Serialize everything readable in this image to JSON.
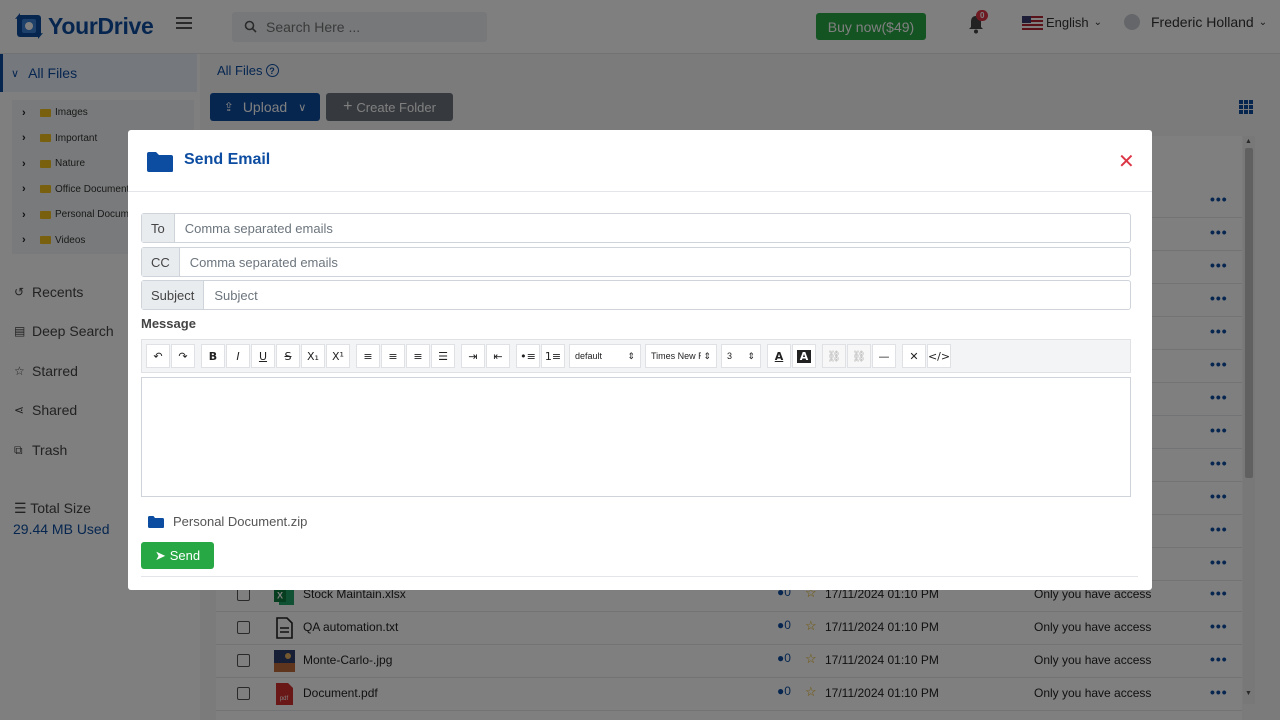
{
  "app": {
    "name": "YourDrive"
  },
  "header": {
    "search_placeholder": "Search Here ...",
    "buy_label": "Buy now($49)",
    "notification_count": "0",
    "language": "English",
    "user_name": "Frederic Holland"
  },
  "sidebar": {
    "all_files": "All Files",
    "tree": [
      {
        "label": "Images"
      },
      {
        "label": "Important"
      },
      {
        "label": "Nature"
      },
      {
        "label": "Office Documents"
      },
      {
        "label": "Personal Documents"
      },
      {
        "label": "Videos"
      }
    ],
    "nav": [
      {
        "label": "Recents",
        "icon": "history-icon"
      },
      {
        "label": "Deep Search",
        "icon": "document-search-icon"
      },
      {
        "label": "Starred",
        "icon": "star-icon"
      },
      {
        "label": "Shared",
        "icon": "share-icon"
      },
      {
        "label": "Trash",
        "icon": "trash-icon"
      }
    ],
    "storage_label": "Total Size",
    "storage_used": "29.44 MB Used"
  },
  "main": {
    "breadcrumb": "All Files",
    "upload_label": "Upload",
    "create_folder_label": "Create Folder",
    "files": [
      {
        "name": "Stock Maintain.xlsx",
        "comments": "0",
        "date": "17/11/2024 01:10 PM",
        "access": "Only you have access",
        "icon": "excel-icon"
      },
      {
        "name": "QA automation.txt",
        "comments": "0",
        "date": "17/11/2024 01:10 PM",
        "access": "Only you have access",
        "icon": "text-file-icon"
      },
      {
        "name": "Monte-Carlo-.jpg",
        "comments": "0",
        "date": "17/11/2024 01:10 PM",
        "access": "Only you have access",
        "icon": "image-thumb-icon"
      },
      {
        "name": "Document.pdf",
        "comments": "0",
        "date": "17/11/2024 01:10 PM",
        "access": "Only you have access",
        "icon": "pdf-icon"
      }
    ]
  },
  "modal": {
    "title": "Send Email",
    "to_label": "To",
    "to_placeholder": "Comma separated emails",
    "cc_label": "CC",
    "cc_placeholder": "Comma separated emails",
    "subject_label": "Subject",
    "subject_placeholder": "Subject",
    "message_label": "Message",
    "toolbar": {
      "style_select": "default",
      "font_select": "Times New Roman",
      "size_select": "3"
    },
    "attachment": "Personal Document.zip",
    "send_label": "Send"
  },
  "colors": {
    "brand": "#0d4da1",
    "success": "#28a745",
    "danger": "#dc3545",
    "secondary": "#6c757d"
  }
}
